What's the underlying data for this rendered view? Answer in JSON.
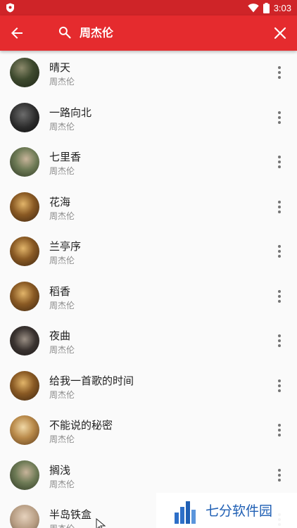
{
  "status_bar": {
    "time": "3:03",
    "icons": [
      "shield-icon",
      "wifi-icon",
      "battery-icon"
    ]
  },
  "app_bar": {
    "back_icon": "arrow-left-icon",
    "search_icon": "search-icon",
    "query": "周杰伦",
    "close_icon": "close-icon"
  },
  "songs": [
    {
      "title": "晴天",
      "artist": "周杰伦"
    },
    {
      "title": "一路向北",
      "artist": "周杰伦"
    },
    {
      "title": "七里香",
      "artist": "周杰伦"
    },
    {
      "title": "花海",
      "artist": "周杰伦"
    },
    {
      "title": "兰亭序",
      "artist": "周杰伦"
    },
    {
      "title": "稻香",
      "artist": "周杰伦"
    },
    {
      "title": "夜曲",
      "artist": "周杰伦"
    },
    {
      "title": "给我一首歌的时间",
      "artist": "周杰伦"
    },
    {
      "title": "不能说的秘密",
      "artist": "周杰伦"
    },
    {
      "title": "搁浅",
      "artist": "周杰伦"
    },
    {
      "title": "半岛铁盒",
      "artist": "周杰伦"
    }
  ],
  "watermark": {
    "text": "七分软件园"
  },
  "colors": {
    "status_bar": "#cf2428",
    "app_bar": "#e52b2e",
    "title_text": "#212121",
    "subtitle_text": "#8a8a8a"
  }
}
